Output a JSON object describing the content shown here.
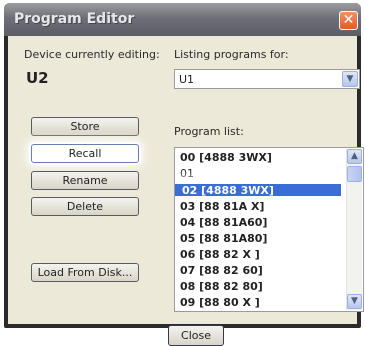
{
  "window": {
    "title": "Program Editor",
    "close_glyph": "✕"
  },
  "device": {
    "label": "Device currently editing:",
    "name": "U2"
  },
  "listing": {
    "label": "Listing programs for:",
    "selected": "U1",
    "arrow_glyph": "▼"
  },
  "program_list": {
    "label": "Program list:",
    "items": [
      {
        "text": "00 [4888 3WX]"
      },
      {
        "text": "01"
      },
      {
        "text": "02 [4888 3WX]"
      },
      {
        "text": "03 [88 81A X]"
      },
      {
        "text": "04 [88 81A60]"
      },
      {
        "text": "05 [88 81A80]"
      },
      {
        "text": "06 [88 82 X ]"
      },
      {
        "text": "07 [88 82 60]"
      },
      {
        "text": "08 [88 82 80]"
      },
      {
        "text": "09 [88 80 X ]"
      }
    ],
    "selected_index": 2,
    "scroll_up_glyph": "▲",
    "scroll_down_glyph": "▼"
  },
  "buttons": {
    "store": "Store",
    "recall": "Recall",
    "rename": "Rename",
    "delete": "Delete",
    "load": "Load From Disk...",
    "close": "Close"
  },
  "icons": {
    "close": "close-icon",
    "dropdown": "chevron-down-icon",
    "scroll_up": "chevron-up-icon",
    "scroll_down": "chevron-down-icon"
  },
  "colors": {
    "selection": "#3a6dd6",
    "titlebar": "#6f6f77",
    "client": "#ece9d8",
    "close_button": "#e35a2a"
  }
}
